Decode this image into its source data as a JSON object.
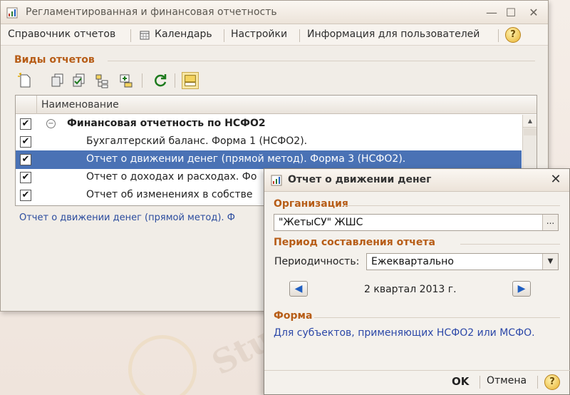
{
  "main_window": {
    "title": "Регламентированная и финансовая отчетность",
    "menu": [
      "Справочник отчетов",
      "Календарь",
      "Настройки",
      "Информация для пользователей"
    ],
    "help_label": "?",
    "section_report_types": "Виды отчетов",
    "grid": {
      "column_header": "Наименование",
      "rows": [
        {
          "label": "Финансовая отчетность по НСФО2",
          "checked": true,
          "group": true
        },
        {
          "label": "Бухгалтерский баланс. Форма 1 (НСФО2).",
          "checked": true
        },
        {
          "label": "Отчет о движении денег (прямой метод). Форма 3 (НСФО2).",
          "checked": true,
          "selected": true
        },
        {
          "label": "Отчет о доходах и расходах. Фо",
          "checked": true
        },
        {
          "label": "Отчет об изменениях в собстве",
          "checked": true
        }
      ]
    },
    "selected_description": "Отчет о движении денег (прямой метод). Ф"
  },
  "dialog": {
    "title": "Отчет о движении денег",
    "section_org": "Организация",
    "org_value": "\"ЖетыСУ\" ЖШС",
    "section_period": "Период составления отчета",
    "periodicity_label": "Периодичность:",
    "periodicity_value": "Ежеквартально",
    "period_value": "2 квартал 2013 г.",
    "section_form": "Форма",
    "form_link": "Для субъектов, применяющих НСФО2 или МСФО.",
    "ok_label": "OK",
    "cancel_label": "Отмена",
    "help_label": "?"
  },
  "watermark_text": "Stud.kz",
  "colors": {
    "section_title": "#b75d17",
    "selection": "#4a72b5",
    "link": "#2c48a8"
  }
}
